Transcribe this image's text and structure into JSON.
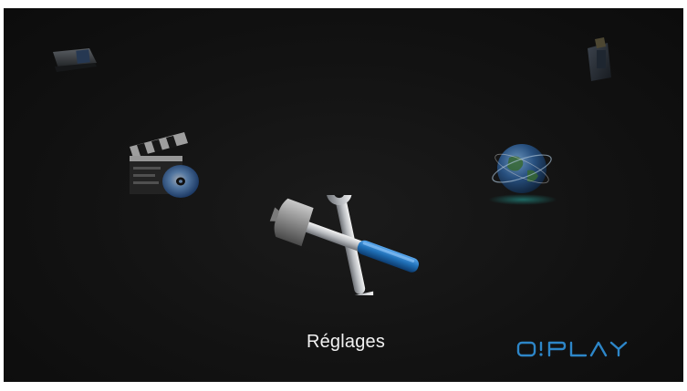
{
  "menu": {
    "selected_label": "Réglages",
    "items": [
      {
        "name": "photo-icon"
      },
      {
        "name": "music-icon"
      },
      {
        "name": "movie-icon"
      },
      {
        "name": "internet-icon"
      },
      {
        "name": "settings-icon"
      }
    ]
  },
  "brand": {
    "logo_text": "O!PLAY",
    "color": "#2d86c8"
  },
  "colors": {
    "background": "#111111",
    "label": "#f2f2f2",
    "accent_blue": "#1f6fb6"
  }
}
